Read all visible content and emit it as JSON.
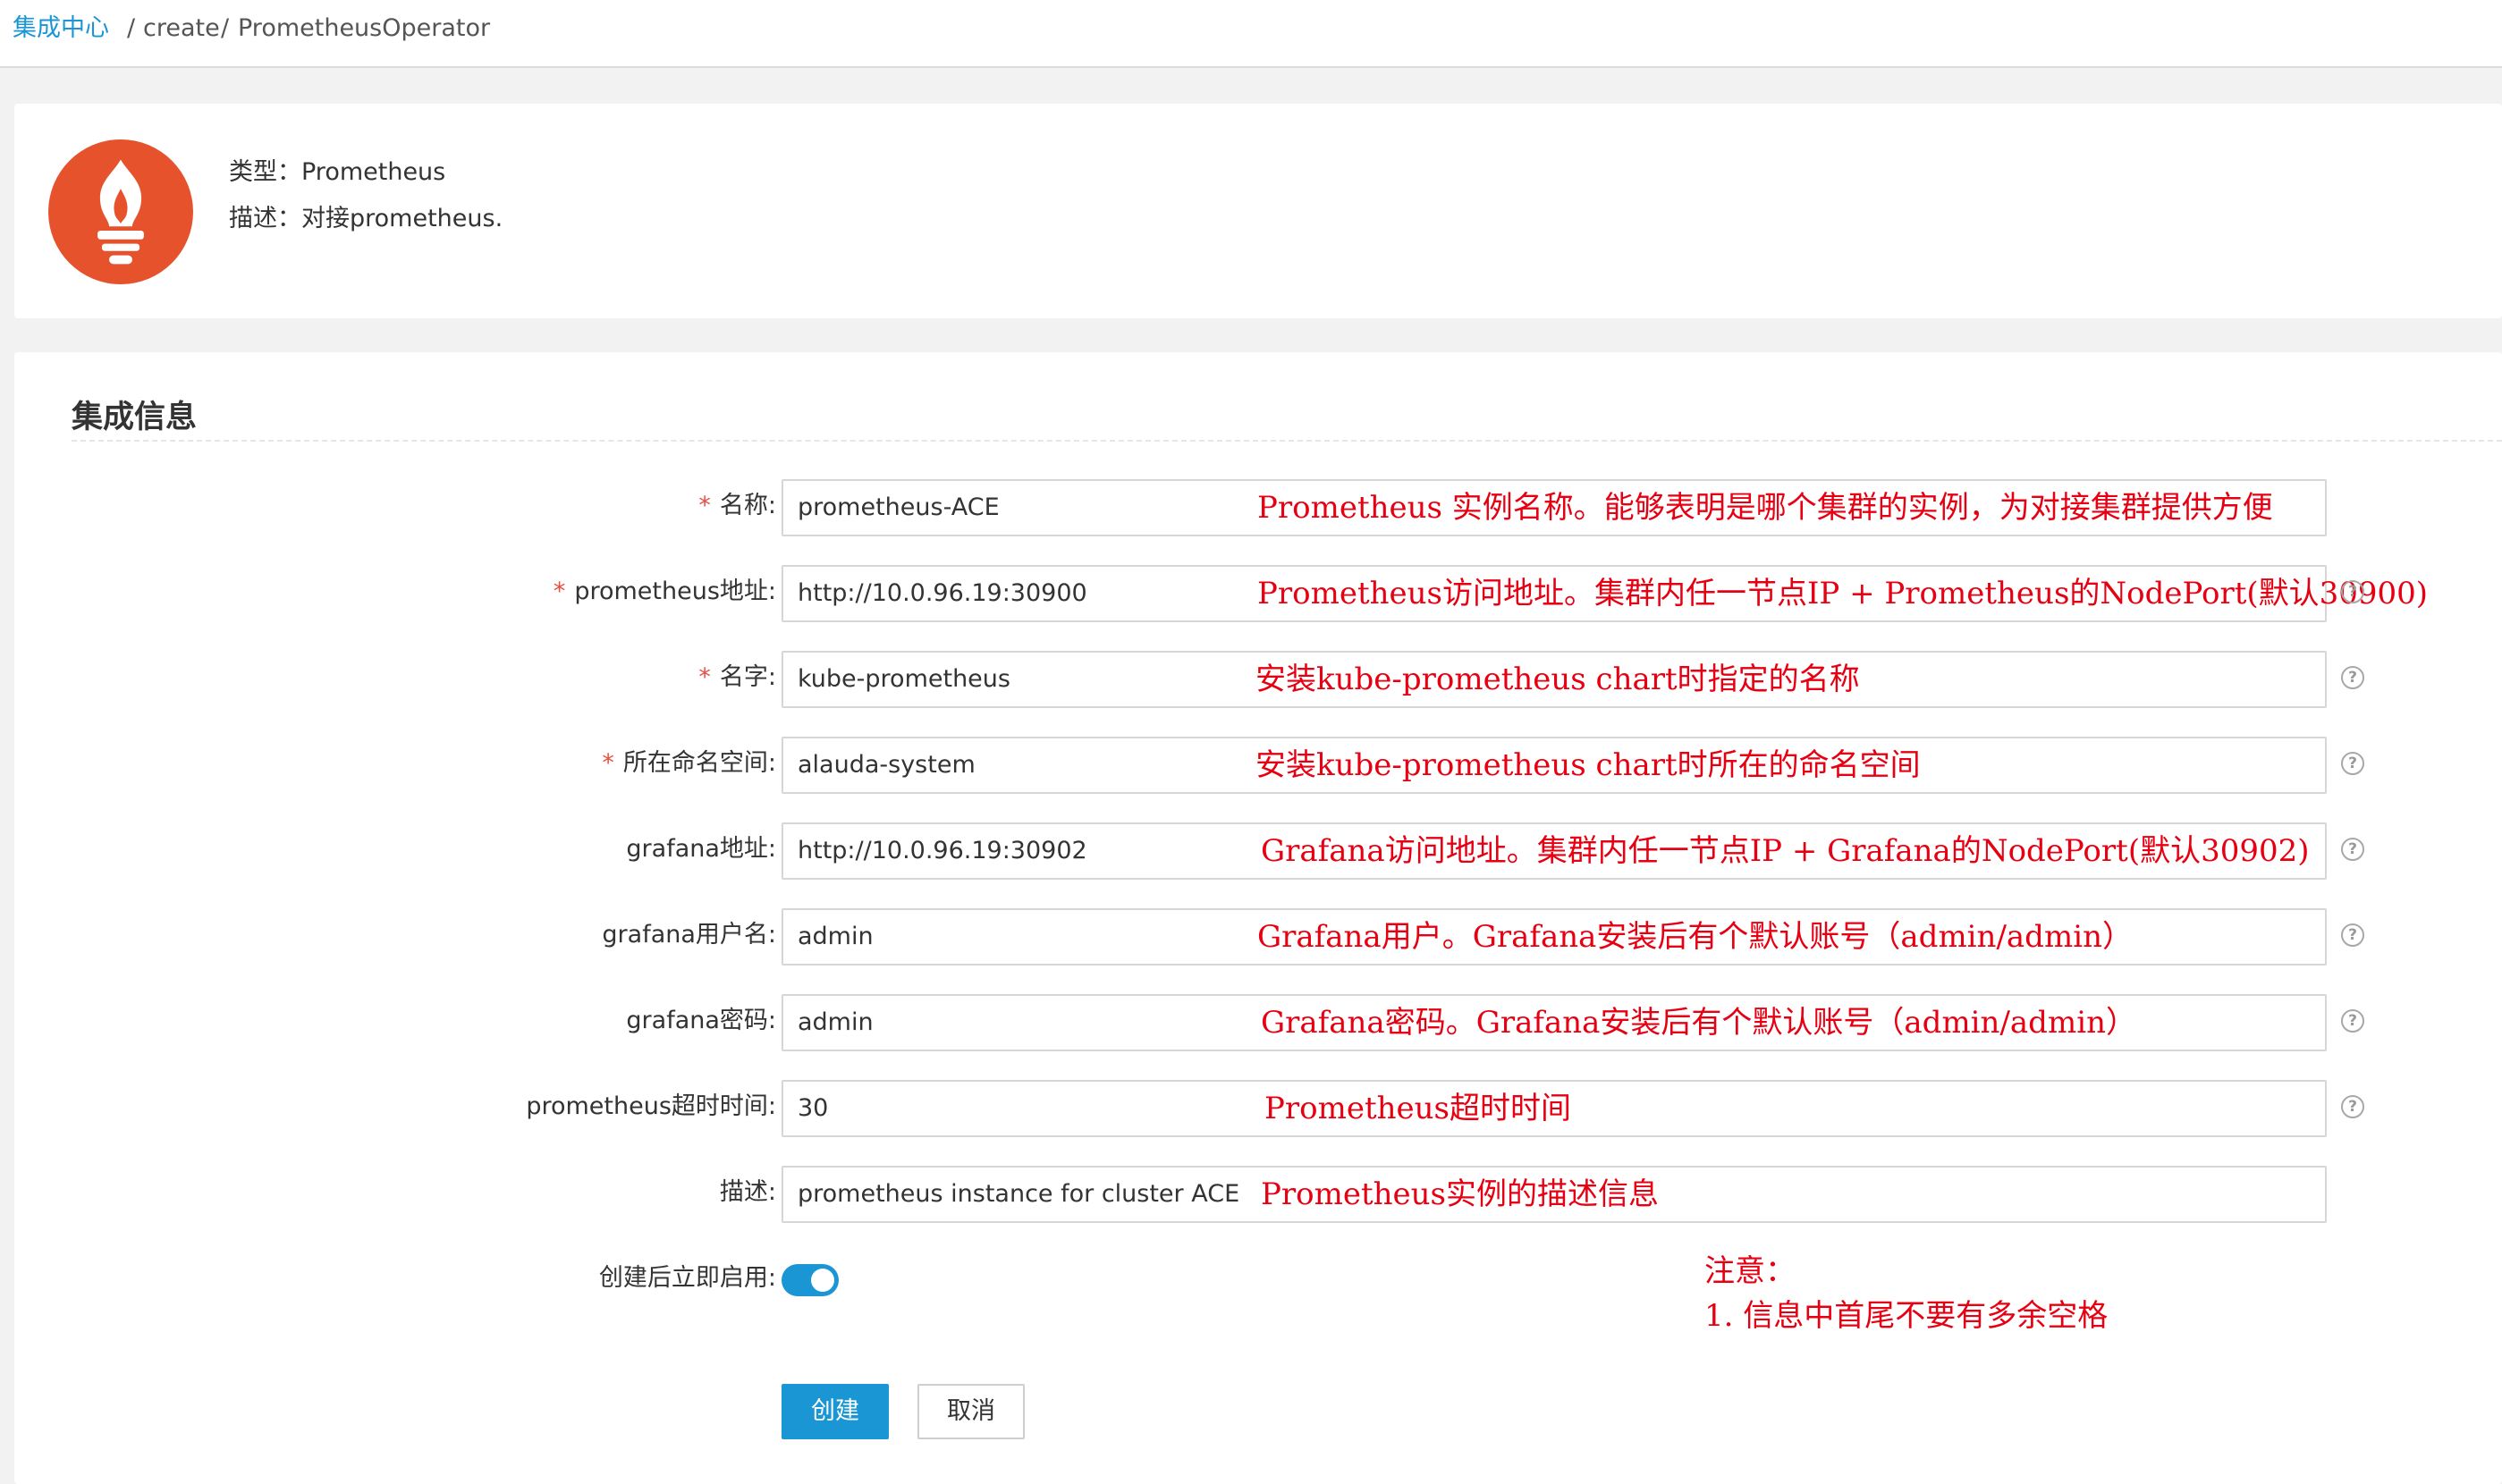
{
  "breadcrumb": {
    "home": "集成中心",
    "sep": "/",
    "create": "create",
    "operator": "PrometheusOperator"
  },
  "info": {
    "type_line": "类型：Prometheus",
    "desc_line": "描述：对接prometheus."
  },
  "section": {
    "title": "集成信息"
  },
  "form": {
    "fields": [
      {
        "label": "名称:",
        "required": true,
        "value": "prometheus-ACE",
        "annotation": "Prometheus 实例名称。能够表明是哪个集群的实例，为对接集群提供方便",
        "help": false
      },
      {
        "label": "prometheus地址:",
        "required": true,
        "value": "http://10.0.96.19:30900",
        "annotation": "Prometheus访问地址。集群内任一节点IP + Prometheus的NodePort(默认30900)",
        "help": true
      },
      {
        "label": "名字:",
        "required": true,
        "value": "kube-prometheus",
        "annotation": "安装kube-prometheus chart时指定的名称",
        "help": true
      },
      {
        "label": "所在命名空间:",
        "required": true,
        "value": "alauda-system",
        "annotation": "安装kube-prometheus chart时所在的命名空间",
        "help": true
      },
      {
        "label": "grafana地址:",
        "required": false,
        "value": "http://10.0.96.19:30902",
        "annotation": "Grafana访问地址。集群内任一节点IP + Grafana的NodePort(默认30902)",
        "help": true
      },
      {
        "label": "grafana用户名:",
        "required": false,
        "value": "admin",
        "annotation": "Grafana用户。Grafana安装后有个默认账号（admin/admin）",
        "help": true
      },
      {
        "label": "grafana密码:",
        "required": false,
        "value": "admin",
        "annotation": "Grafana密码。Grafana安装后有个默认账号（admin/admin）",
        "help": true
      },
      {
        "label": "prometheus超时时间:",
        "required": false,
        "value": "30",
        "annotation": "Prometheus超时时间",
        "help": true
      },
      {
        "label": "描述:",
        "required": false,
        "value": "prometheus instance for cluster ACE",
        "annotation": "Prometheus实例的描述信息",
        "help": false
      }
    ],
    "enable_label": "创建后立即启用:",
    "enable_on": true,
    "help_glyph": "?",
    "required_mark": "*"
  },
  "note": {
    "title": "注意：",
    "line1": "1. 信息中首尾不要有多余空格"
  },
  "buttons": {
    "create": "创建",
    "cancel": "取消"
  },
  "colors": {
    "accent": "#1a96d4",
    "annotation": "#e60012",
    "logo": "#e6522c"
  }
}
